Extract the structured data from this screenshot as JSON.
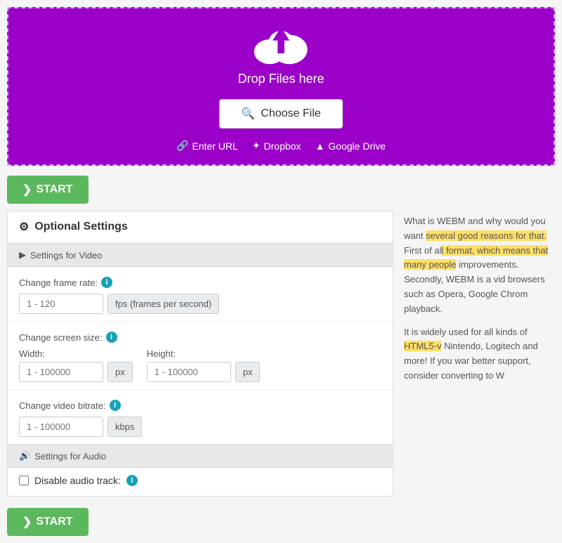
{
  "dropzone": {
    "drop_text": "Drop Files here",
    "choose_file_label": "Choose File",
    "search_icon": "🔍",
    "sources": [
      {
        "id": "enter-url",
        "label": "Enter URL",
        "icon": "🔗"
      },
      {
        "id": "dropbox",
        "label": "Dropbox",
        "icon": "📦"
      },
      {
        "id": "google-drive",
        "label": "Google Drive",
        "icon": "▲"
      }
    ],
    "bg_color": "#9b00c9",
    "border_color": "#e0a0ff"
  },
  "start_button": {
    "label": "START"
  },
  "settings_panel": {
    "title": "Optional Settings",
    "gear_icon": "⚙",
    "video_section": {
      "header": "Settings for Video",
      "video_icon": "▶",
      "frame_rate": {
        "label": "Change frame rate:",
        "placeholder": "1 - 120",
        "unit": "fps (frames per second)"
      },
      "screen_size": {
        "label": "Change screen size:",
        "width_label": "Width:",
        "width_placeholder": "1 - 100000",
        "width_unit": "px",
        "height_label": "Height:",
        "height_placeholder": "1 - 100000",
        "height_unit": "px"
      },
      "bitrate": {
        "label": "Change video bitrate:",
        "placeholder": "1 - 100000",
        "unit": "kbps"
      }
    },
    "audio_section": {
      "header": "Settings for Audio",
      "audio_icon": "🔊",
      "disable_audio": {
        "label": "Disable audio track:"
      }
    }
  },
  "info_panel": {
    "paragraphs": [
      "What is WEBM and why would you want several good reasons for that. First of all format, which means that many people improvements. Secondly, WEBM is a vid browsers such as Opera, Google Chrom playback.",
      "It is widely used for all kinds of HTML5-v Nintendo, Logitech and more! If you war better support, consider converting to W"
    ]
  }
}
